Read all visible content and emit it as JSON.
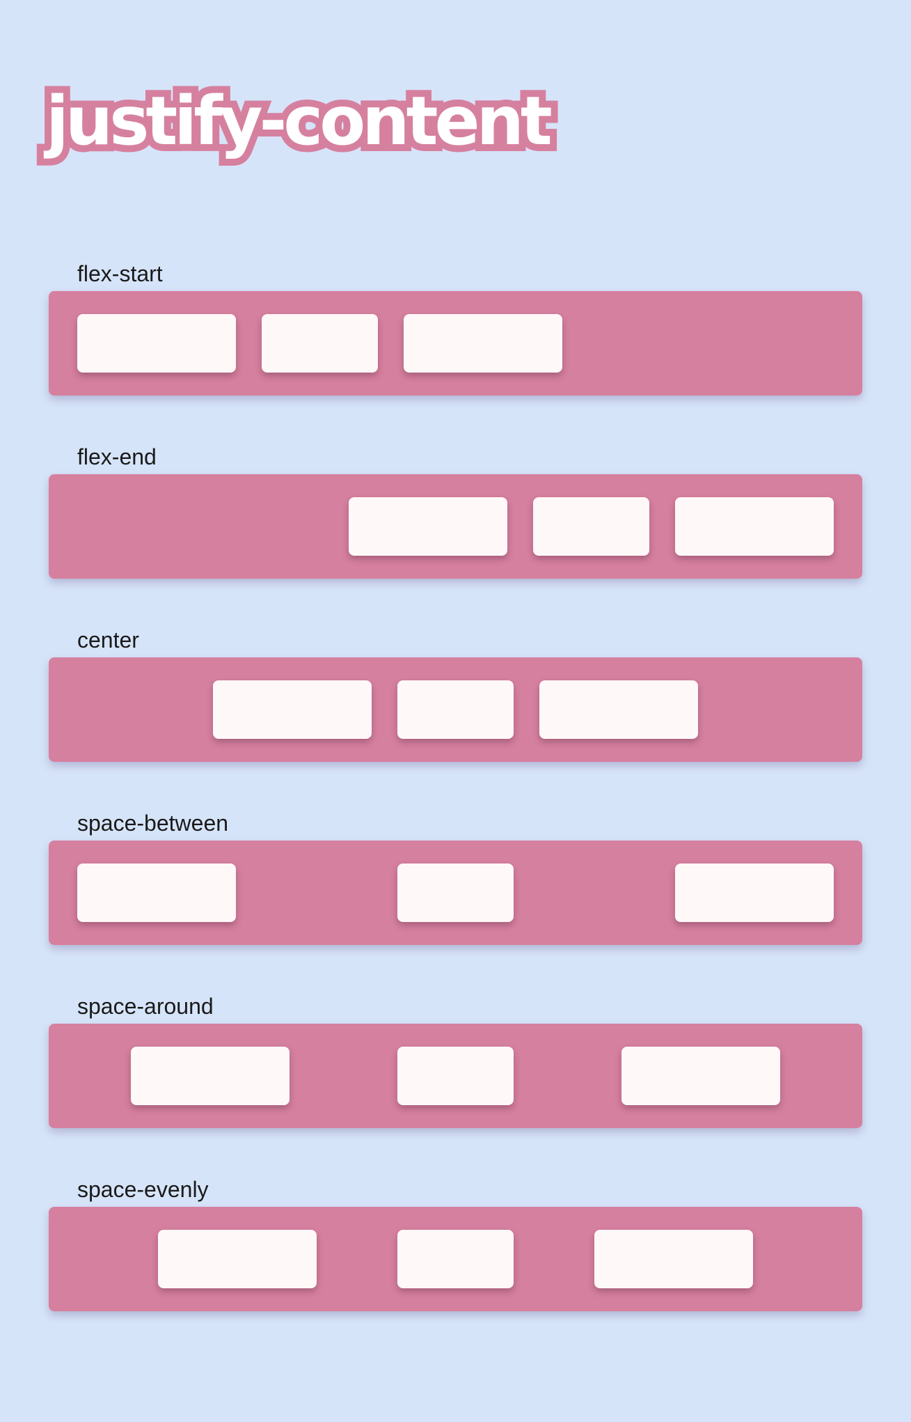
{
  "title": "justify-content",
  "colors": {
    "background": "#d6e4f9",
    "container": "#d6809f",
    "item": "#fff8f8",
    "title_outline": "#d6809f"
  },
  "examples": [
    {
      "label": "flex-start",
      "justify": "flex-start"
    },
    {
      "label": "flex-end",
      "justify": "flex-end"
    },
    {
      "label": "center",
      "justify": "center"
    },
    {
      "label": "space-between",
      "justify": "space-between"
    },
    {
      "label": "space-around",
      "justify": "space-around"
    },
    {
      "label": "space-evenly",
      "justify": "space-evenly"
    }
  ]
}
